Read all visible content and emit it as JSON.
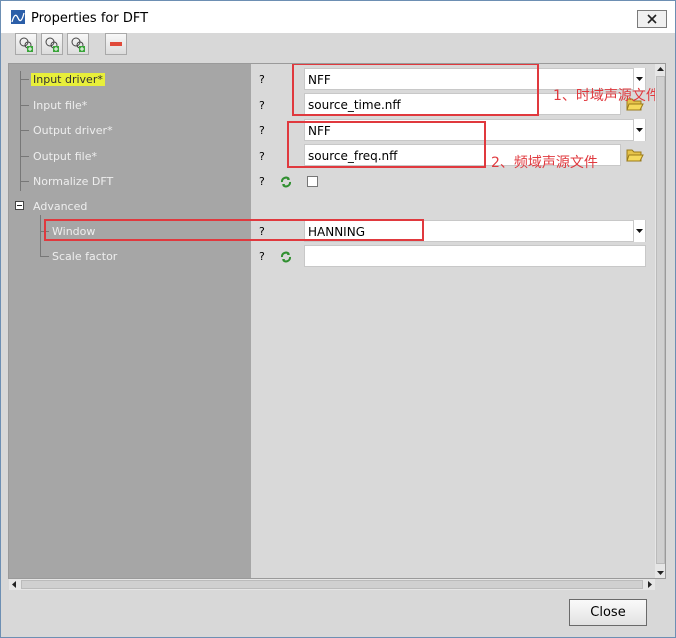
{
  "window": {
    "title": "Properties for DFT"
  },
  "toolbar": {
    "buttons": [
      "add-icon-1",
      "add-icon-2",
      "add-icon-3",
      "remove-icon"
    ]
  },
  "tree": {
    "rows": [
      {
        "label": "Input driver*",
        "help": "?"
      },
      {
        "label": "Input file*",
        "help": "?"
      },
      {
        "label": "Output driver*",
        "help": "?"
      },
      {
        "label": "Output file*",
        "help": "?"
      },
      {
        "label": "Normalize DFT",
        "help": "?"
      },
      {
        "label": "Advanced"
      },
      {
        "label": "Window",
        "help": "?"
      },
      {
        "label": "Scale factor",
        "help": "?"
      }
    ]
  },
  "fields": {
    "input_driver": "NFF",
    "input_file": "source_time.nff",
    "output_driver": "NFF",
    "output_file": "source_freq.nff",
    "window": "HANNING",
    "scale_factor": "",
    "normalize_checked": false
  },
  "annotations": {
    "time_domain": "1、时域声源文件",
    "freq_domain": "2、频域声源文件"
  },
  "footer": {
    "close_label": "Close"
  },
  "colors": {
    "highlight": "#e8ef3a",
    "annotation_red": "#e0393e",
    "tree_bg": "#a6a6a6"
  }
}
